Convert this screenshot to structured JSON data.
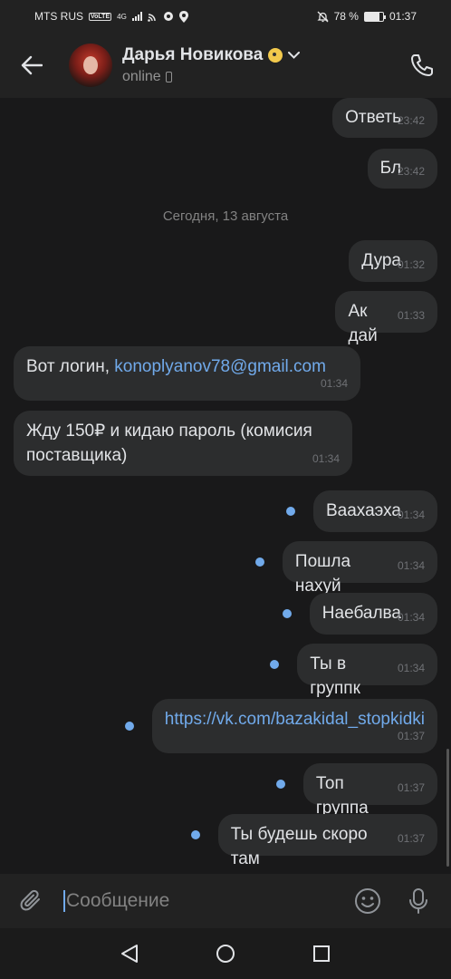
{
  "status_bar": {
    "carrier": "MTS RUS",
    "volte": "VoLTE",
    "network": "4G",
    "battery_percent": "78 %",
    "battery_level": 0.78,
    "time": "01:37"
  },
  "header": {
    "contact_name": "Дарья Новикова",
    "presence": "online"
  },
  "chat": {
    "date_separator": "Сегодня, 13 августа",
    "messages": [
      {
        "text": "Ответь",
        "time": "23:42"
      },
      {
        "text": "Бл",
        "time": "23:42"
      },
      {
        "text": "Дура",
        "time": "01:32"
      },
      {
        "text": "Ак дай",
        "time": "01:33"
      },
      {
        "text": "Вот логин, ",
        "link": "konoplyanov78@gmail.com",
        "time": "01:34"
      },
      {
        "text": "Жду 150₽ и кидаю пароль (комисия поставщика)",
        "time": "01:34"
      },
      {
        "text": "Ваахаэха",
        "time": "01:34"
      },
      {
        "text": "Пошла нахуй",
        "time": "01:34"
      },
      {
        "text": "Наебалва",
        "time": "01:34"
      },
      {
        "text": "Ты в группк",
        "time": "01:34"
      },
      {
        "link": "https://vk.com/bazakidal_stopkidki",
        "time": "01:37"
      },
      {
        "text": "Топ группа",
        "time": "01:37"
      },
      {
        "text": "Ты будешь скоро там",
        "time": "01:37"
      }
    ]
  },
  "composer": {
    "placeholder": "Сообщение"
  },
  "icons": {
    "back": "arrow-left-icon",
    "call": "phone-icon",
    "attach": "paperclip-icon",
    "emoji": "smile-icon",
    "mic": "microphone-icon"
  },
  "colors": {
    "background": "#19191a",
    "bar": "#222222",
    "bubble": "#2c2d2e",
    "accent": "#71aaeb"
  }
}
